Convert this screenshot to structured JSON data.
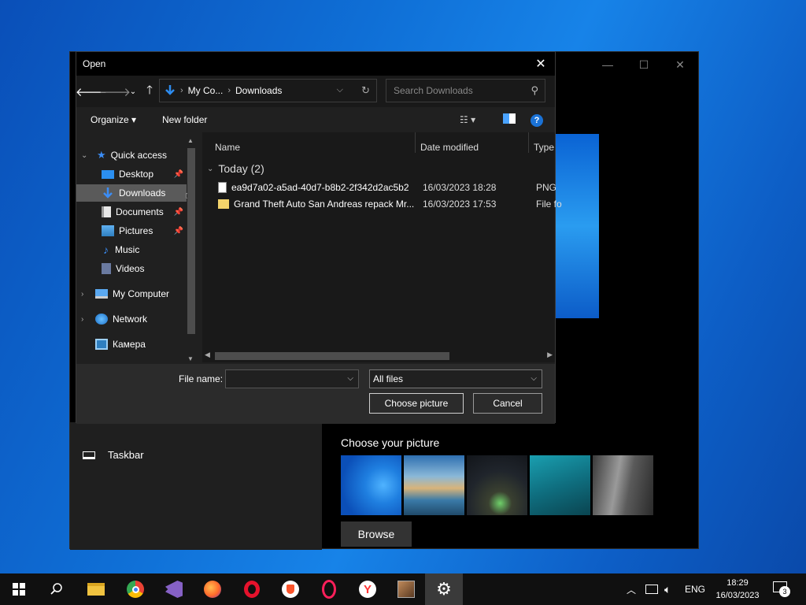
{
  "dialog": {
    "title": "Open",
    "breadcrumb": [
      "My Co...",
      "Downloads"
    ],
    "search_placeholder": "Search Downloads",
    "organize_label": "Organize",
    "new_folder_label": "New folder",
    "help_label": "?",
    "nav_tree": [
      {
        "label": "Quick access",
        "icon": "star-icon"
      },
      {
        "label": "Desktop",
        "icon": "desktop-icon",
        "pinned": true
      },
      {
        "label": "Downloads",
        "icon": "download-icon",
        "pinned": true,
        "selected": true
      },
      {
        "label": "Documents",
        "icon": "document-icon",
        "pinned": true
      },
      {
        "label": "Pictures",
        "icon": "picture-icon",
        "pinned": true
      },
      {
        "label": "Music",
        "icon": "music-icon"
      },
      {
        "label": "Videos",
        "icon": "video-icon"
      },
      {
        "label": "My Computer",
        "icon": "computer-icon"
      },
      {
        "label": "Network",
        "icon": "network-icon"
      },
      {
        "label": "Камера",
        "icon": "camera-icon"
      }
    ],
    "columns": [
      "Name",
      "Date modified",
      "Type"
    ],
    "group_label": "Today (2)",
    "files": [
      {
        "name": "ea9d7a02-a5ad-40d7-b8b2-2f342d2ac5b2",
        "date": "16/03/2023 18:28",
        "type": "PNG"
      },
      {
        "name": "Grand Theft Auto San Andreas repack Mr...",
        "date": "16/03/2023 17:53",
        "type": "File fo"
      }
    ],
    "file_name_label": "File name:",
    "file_name_value": "",
    "file_type_value": "All files",
    "choose_button": "Choose picture",
    "cancel_button": "Cancel"
  },
  "settings": {
    "nav_item": "Taskbar",
    "choose_title": "Choose your picture",
    "browse_button": "Browse"
  },
  "taskbar": {
    "apps": [
      "file-explorer",
      "chrome",
      "visual-studio",
      "firefox",
      "opera",
      "brave",
      "opera-gx",
      "yandex",
      "game",
      "settings"
    ],
    "language": "ENG",
    "time": "18:29",
    "date": "16/03/2023",
    "notification_count": "3"
  },
  "colors": {
    "accent": "#1a72d6",
    "dialog_bg": "#202020",
    "selection": "#5a5a5a"
  }
}
